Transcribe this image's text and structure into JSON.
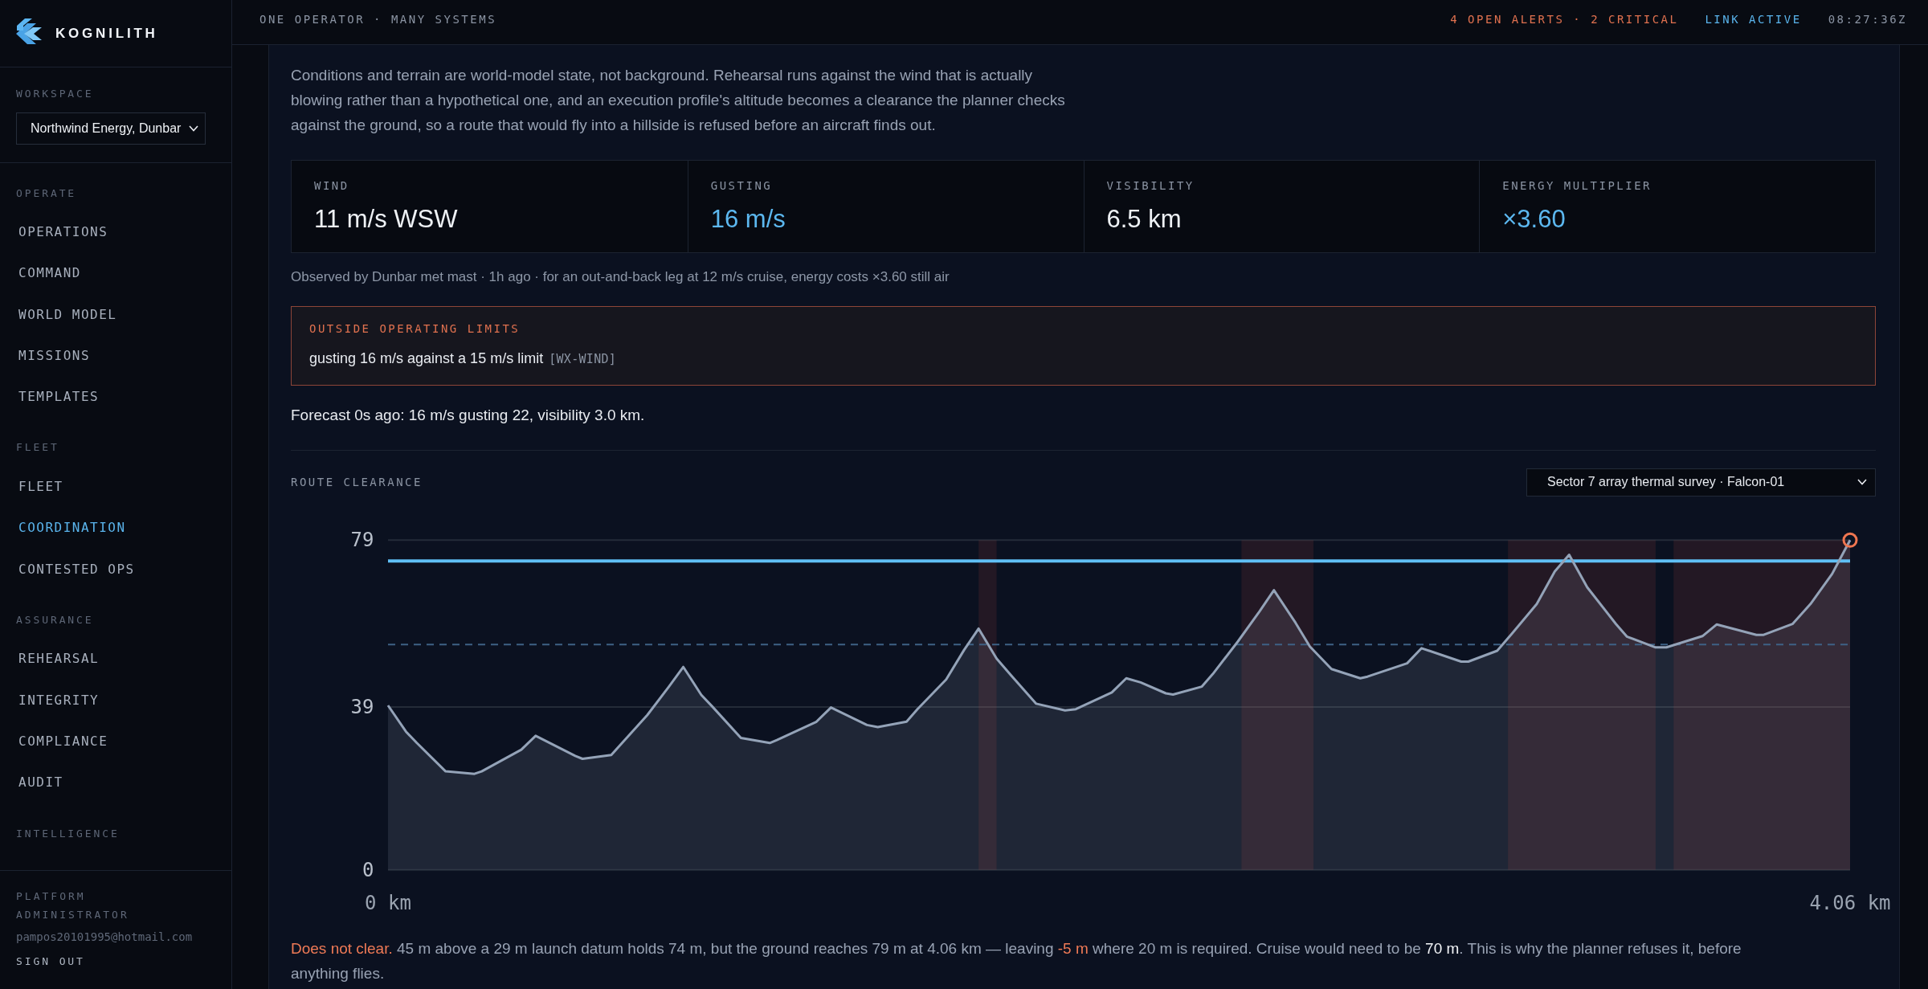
{
  "sidebar": {
    "brand": "KOGNILITH",
    "workspace": {
      "label": "WORKSPACE",
      "value": "Northwind Energy, Dunbar"
    },
    "groups": [
      {
        "label": "OPERATE",
        "items": [
          {
            "label": "OPERATIONS",
            "selected": false
          },
          {
            "label": "COMMAND",
            "selected": false
          },
          {
            "label": "WORLD MODEL",
            "selected": false
          },
          {
            "label": "MISSIONS",
            "selected": false
          },
          {
            "label": "TEMPLATES",
            "selected": false
          }
        ]
      },
      {
        "label": "FLEET",
        "items": [
          {
            "label": "FLEET",
            "selected": false
          },
          {
            "label": "COORDINATION",
            "selected": true
          },
          {
            "label": "CONTESTED OPS",
            "selected": false
          }
        ]
      },
      {
        "label": "ASSURANCE",
        "items": [
          {
            "label": "REHEARSAL",
            "selected": false
          },
          {
            "label": "INTEGRITY",
            "selected": false
          },
          {
            "label": "COMPLIANCE",
            "selected": false
          },
          {
            "label": "AUDIT",
            "selected": false
          }
        ]
      },
      {
        "label": "INTELLIGENCE"
      }
    ],
    "user": {
      "role": "PLATFORM ADMINISTRATOR",
      "email": "pampos20101995@hotmail.com",
      "sign_out": "SIGN OUT"
    }
  },
  "top_bar": {
    "tagline": "ONE OPERATOR · MANY SYSTEMS",
    "alerts": "4 OPEN ALERTS · 2 CRITICAL",
    "link": "LINK ACTIVE",
    "clock": "08:27:36Z"
  },
  "intro": "Conditions and terrain are world-model state, not background. Rehearsal runs against the wind that is actually blowing rather than a hypothetical one, and an execution profile's altitude becomes a clearance the planner checks against the ground, so a route that would fly into a hillside is refused before an aircraft finds out.",
  "conditions": [
    {
      "label": "WIND",
      "value": "11 m/s WSW",
      "accent": false
    },
    {
      "label": "GUSTING",
      "value": "16 m/s",
      "accent": true
    },
    {
      "label": "VISIBILITY",
      "value": "6.5 km",
      "accent": false
    },
    {
      "label": "ENERGY MULTIPLIER",
      "value": "×3.60",
      "accent": true
    }
  ],
  "observation": "Observed by Dunbar met mast · 1h ago · for an out-and-back leg at 12 m/s cruise, energy costs ×3.60 still air",
  "alert": {
    "title": "OUTSIDE OPERATING LIMITS",
    "message": "gusting 16 m/s against a 15 m/s limit",
    "code": "[WX-WIND]"
  },
  "forecast": "Forecast 0s ago: 16 m/s gusting 22, visibility 3.0 km.",
  "route_clearance": {
    "title": "ROUTE CLEARANCE",
    "route_select": "Sector 7 array thermal survey · Falcon-01",
    "chart_data": {
      "type": "area",
      "x": [
        0,
        0.05,
        0.08,
        0.16,
        0.24,
        0.26,
        0.37,
        0.41,
        0.52,
        0.54,
        0.62,
        0.65,
        0.72,
        0.78,
        0.82,
        0.87,
        0.9,
        0.98,
        1.06,
        1.08,
        1.19,
        1.23,
        1.33,
        1.36,
        1.44,
        1.47,
        1.55,
        1.6,
        1.64,
        1.69,
        1.73,
        1.8,
        1.88,
        1.91,
        2.01,
        2.05,
        2.09,
        2.16,
        2.18,
        2.26,
        2.29,
        2.36,
        2.42,
        2.46,
        2.52,
        2.56,
        2.62,
        2.7,
        2.72,
        2.83,
        2.87,
        2.98,
        3.0,
        3.08,
        3.12,
        3.19,
        3.24,
        3.28,
        3.33,
        3.41,
        3.44,
        3.52,
        3.55,
        3.65,
        3.69,
        3.8,
        3.82,
        3.9,
        3.95,
        4.01,
        4.06
      ],
      "series": [
        {
          "color": "#94a3b8",
          "values": [
            39.4,
            33.1,
            30.4,
            23.6,
            23.0,
            23.6,
            28.8,
            32.1,
            27.3,
            26.6,
            27.5,
            30.4,
            37.1,
            43.9,
            48.6,
            41.9,
            39.2,
            31.6,
            30.4,
            31.1,
            35.5,
            38.9,
            34.7,
            34.2,
            35.5,
            38.5,
            45.6,
            52.7,
            57.8,
            50.6,
            46.6,
            39.8,
            38.2,
            38.5,
            42.5,
            45.9,
            44.9,
            42.3,
            42.0,
            43.9,
            46.9,
            54.7,
            61.9,
            67.0,
            59.2,
            53.5,
            48.1,
            45.9,
            46.3,
            49.5,
            53.1,
            49.9,
            49.9,
            52.5,
            56.5,
            63.7,
            71.5,
            75.5,
            67.7,
            58.9,
            55.9,
            53.3,
            53.3,
            56.0,
            58.8,
            56.3,
            56.3,
            58.9,
            63.7,
            70.9,
            79
          ]
        }
      ],
      "xlim": [
        0,
        4.06
      ],
      "ylim": [
        0,
        79
      ],
      "xticks": [
        {
          "value": 0,
          "label": "0 km"
        },
        {
          "value": 4.06,
          "label": "4.06 km"
        }
      ],
      "yticks": [
        0,
        39,
        79
      ],
      "ref_lines": [
        {
          "axis": "y",
          "value": 74,
          "color": "#5fbff5"
        },
        {
          "axis": "y",
          "value": 54,
          "color": "#3e6185"
        }
      ],
      "bands": [
        {
          "axis": "x",
          "from": 1.64,
          "to": 1.69
        },
        {
          "axis": "x",
          "from": 2.37,
          "to": 2.57
        },
        {
          "axis": "x",
          "from": 3.11,
          "to": 3.52
        },
        {
          "axis": "x",
          "from": 3.57,
          "to": 4.06
        }
      ]
    }
  },
  "verdict": [
    {
      "text": "Does not clear.",
      "warning": true,
      "highlight": false
    },
    {
      "text": " 45 m above a 29 m launch datum holds 74 m, but the ground reaches 79 m at 4.06 km — leaving ",
      "warning": false,
      "highlight": false
    },
    {
      "text": "-5 m",
      "warning": true,
      "highlight": false
    },
    {
      "text": " where 20 m is required. Cruise would need to be ",
      "warning": false,
      "highlight": false
    },
    {
      "text": "70 m",
      "warning": false,
      "highlight": true
    },
    {
      "text": ". This is why the planner refuses it, before anything flies.",
      "warning": false,
      "highlight": false
    }
  ]
}
